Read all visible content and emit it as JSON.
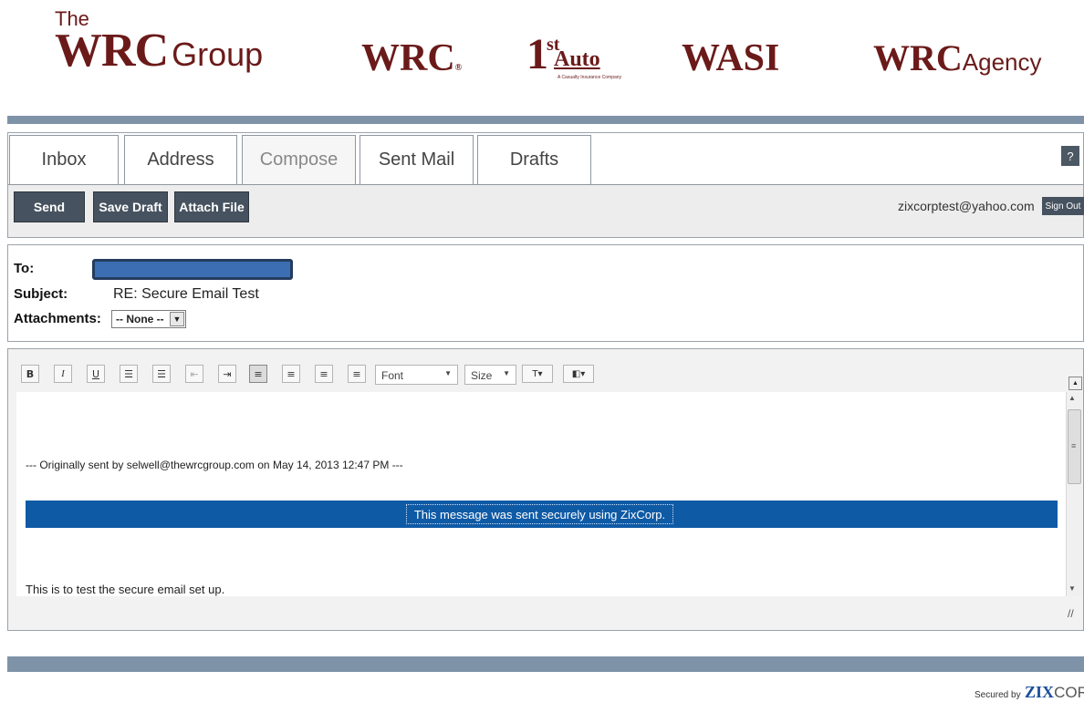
{
  "brands": {
    "the": "The",
    "wrc_group_big": "WRC",
    "wrc_group_small": "Group",
    "wrc": "WRC",
    "wrc_reg": "®",
    "first_auto_one": "1",
    "first_auto_st": "st",
    "first_auto_auto": "Auto",
    "first_auto_tagline": "A Casualty Insurance Company",
    "wasi": "WASI",
    "agency_big": "WRC",
    "agency_small": "Agency"
  },
  "tabs": [
    {
      "label": "Inbox"
    },
    {
      "label": "Address"
    },
    {
      "label": "Compose",
      "active": true
    },
    {
      "label": "Sent Mail"
    },
    {
      "label": "Drafts"
    }
  ],
  "help_label": "?",
  "toolbar": {
    "send": "Send",
    "save_draft": "Save Draft",
    "attach_file": "Attach File"
  },
  "user": {
    "email": "zixcorptest@yahoo.com",
    "sign_out": "Sign Out"
  },
  "compose": {
    "to_label": "To:",
    "to_value": "",
    "subject_label": "Subject:",
    "subject_value": "RE: Secure Email Test",
    "attachments_label": "Attachments:",
    "attachments_selected": "-- None --"
  },
  "editor": {
    "buttons": [
      {
        "icon": "bold-icon",
        "glyph": "B"
      },
      {
        "icon": "italic-icon",
        "glyph": "I"
      },
      {
        "icon": "underline-icon",
        "glyph": "U"
      },
      {
        "icon": "ordered-list-icon",
        "glyph": "☰"
      },
      {
        "icon": "unordered-list-icon",
        "glyph": "☰"
      },
      {
        "icon": "outdent-icon",
        "glyph": "⇤"
      },
      {
        "icon": "indent-icon",
        "glyph": "⇥"
      },
      {
        "icon": "align-left-icon",
        "glyph": "≡"
      },
      {
        "icon": "align-center-icon",
        "glyph": "≡"
      },
      {
        "icon": "align-right-icon",
        "glyph": "≡"
      },
      {
        "icon": "justify-icon",
        "glyph": "≡"
      }
    ],
    "font_label": "Font",
    "size_label": "Size",
    "original_line": "--- Originally sent by selwell@thewrcgroup.com on May 14, 2013 12:47 PM ---",
    "banner_text": "This message was sent securely using ZixCorp.",
    "body_text": "This is to test the secure email set up."
  },
  "footer": {
    "secured_by": "Secured by",
    "zix": "ZIX",
    "corp": "CORP"
  },
  "colors": {
    "brand": "#6b1a1a",
    "bar": "#7f93a8",
    "button": "#46525f",
    "banner": "#0f5aa5",
    "to_field": "#3c6eb4"
  }
}
